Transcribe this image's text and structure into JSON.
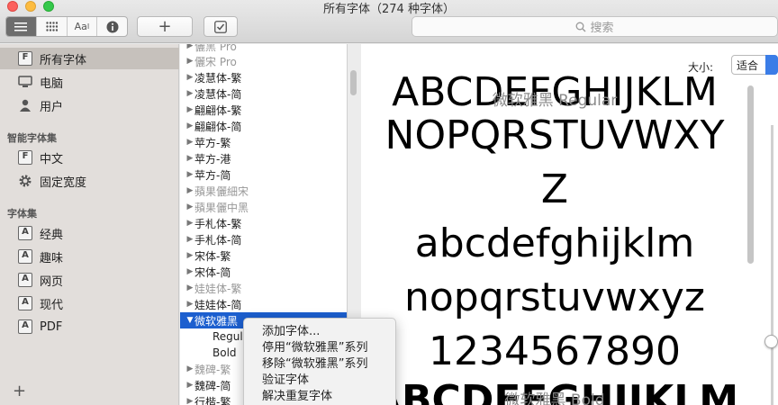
{
  "window": {
    "title": "所有字体（274 种字体）"
  },
  "toolbar": {
    "view_buttons": [
      "list-view",
      "grid-view",
      "sample-view",
      "info"
    ],
    "sample_label": "Aa",
    "add_label": "+",
    "search_placeholder": "搜索"
  },
  "sidebar": {
    "library_items": [
      {
        "label": "所有字体",
        "icon": "font-box-icon",
        "selected": true
      },
      {
        "label": "电脑",
        "icon": "computer-icon"
      },
      {
        "label": "用户",
        "icon": "user-icon"
      }
    ],
    "smart_heading": "智能字体集",
    "smart_items": [
      {
        "label": "中文",
        "icon": "font-box-icon"
      },
      {
        "label": "固定宽度",
        "icon": "gear-icon"
      }
    ],
    "collections_heading": "字体集",
    "collection_items": [
      {
        "label": "经典"
      },
      {
        "label": "趣味"
      },
      {
        "label": "网页"
      },
      {
        "label": "现代"
      },
      {
        "label": "PDF"
      }
    ],
    "add_label": "+"
  },
  "font_list": [
    {
      "label": "儷黑 Pro",
      "dim": true
    },
    {
      "label": "儷宋 Pro",
      "dim": true
    },
    {
      "label": "凌慧体-繁"
    },
    {
      "label": "凌慧体-简"
    },
    {
      "label": "翩翩体-繁"
    },
    {
      "label": "翩翩体-简"
    },
    {
      "label": "苹方-繁"
    },
    {
      "label": "苹方-港"
    },
    {
      "label": "苹方-简"
    },
    {
      "label": "蘋果儷細宋",
      "dim": true
    },
    {
      "label": "蘋果儷中黑",
      "dim": true
    },
    {
      "label": "手札体-繁"
    },
    {
      "label": "手札体-简"
    },
    {
      "label": "宋体-繁"
    },
    {
      "label": "宋体-简"
    },
    {
      "label": "娃娃体-繁",
      "dim": true
    },
    {
      "label": "娃娃体-简"
    },
    {
      "label": "微软雅黑",
      "selected": true,
      "expanded": true
    },
    {
      "label": "Regular",
      "sub": true
    },
    {
      "label": "Bold",
      "sub": true
    },
    {
      "label": "魏碑-繁",
      "dim": true
    },
    {
      "label": "魏碑-简"
    },
    {
      "label": "行楷-繁"
    }
  ],
  "preview": {
    "size_label": "大小:",
    "size_value": "适合",
    "caption_regular": "微软雅黑 Regular",
    "caption_bold": "微软雅黑 Bold",
    "lines": [
      "ABCDEFGHIJKLM",
      "NOPQRSTUVWXY",
      "Z",
      "abcdefghijklm",
      "nopqrstuvwxyz",
      "1234567890",
      "ABCDEFGHIJKLM"
    ]
  },
  "context_menu": {
    "items": [
      "添加字体...",
      "停用“微软雅黑”系列",
      "移除“微软雅黑”系列",
      "验证字体",
      "解决重复字体"
    ]
  }
}
